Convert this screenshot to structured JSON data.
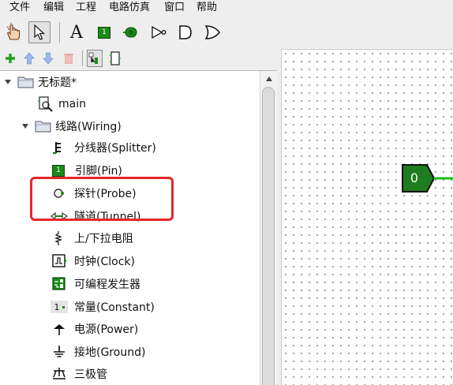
{
  "menu": [
    "文件",
    "编辑",
    "工程",
    "电路仿真",
    "窗口",
    "帮助"
  ],
  "tree": {
    "project": "无标题*",
    "main_circuit": "main",
    "folder": "线路(Wiring)",
    "items": [
      {
        "label": "分线器(Splitter)",
        "icon": "splitter-icon"
      },
      {
        "label": "引脚(Pin)",
        "icon": "pin-icon"
      },
      {
        "label": "探针(Probe)",
        "icon": "probe-icon"
      },
      {
        "label": "隧道(Tunnel)",
        "icon": "tunnel-icon"
      },
      {
        "label": "上/下拉电阻",
        "icon": "pull-resistor-icon"
      },
      {
        "label": "时钟(Clock)",
        "icon": "clock-icon"
      },
      {
        "label": "可编程发生器",
        "icon": "programmable-generator-icon"
      },
      {
        "label": "常量(Constant)",
        "icon": "constant-icon"
      },
      {
        "label": "电源(Power)",
        "icon": "power-icon"
      },
      {
        "label": "接地(Ground)",
        "icon": "ground-icon"
      },
      {
        "label": "三极管",
        "icon": "transistor-icon"
      }
    ]
  },
  "toolbar": {
    "text_tool_glyph": "A",
    "pin_glyph": "1"
  },
  "canvas": {
    "pin_value": "0"
  },
  "icons": {
    "constant_value": "1"
  },
  "colors": {
    "component_green": "#1a8a1a",
    "highlight_red": "#e8262a",
    "add_green": "#22a022",
    "arrow_blue": "#7aa0e0"
  }
}
